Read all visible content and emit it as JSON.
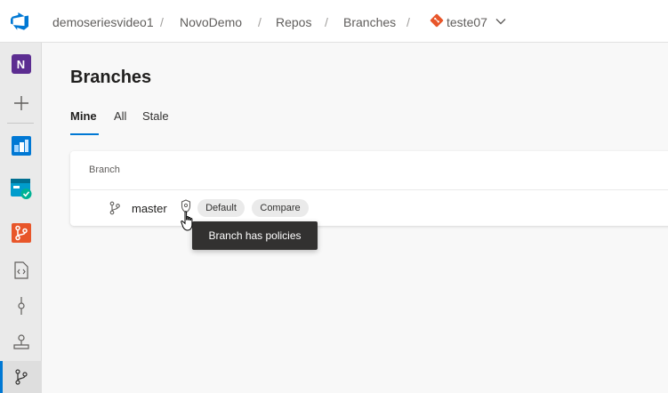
{
  "breadcrumb": {
    "organization": "demoseriesvideo1",
    "project": "NovoDemo",
    "section": "Repos",
    "page": "Branches",
    "repository": "teste07",
    "separator": "/"
  },
  "sidebar": {
    "project_initial": "N",
    "items": [
      {
        "icon": "project-badge"
      },
      {
        "icon": "plus-icon"
      },
      {
        "icon": "boards-icon"
      },
      {
        "icon": "test-plans-icon"
      },
      {
        "icon": "repos-icon"
      },
      {
        "icon": "files-icon"
      },
      {
        "icon": "commits-icon"
      },
      {
        "icon": "pushes-icon"
      },
      {
        "icon": "branches-icon",
        "active": true
      }
    ]
  },
  "main": {
    "title": "Branches",
    "tabs": [
      {
        "label": "Mine",
        "active": true
      },
      {
        "label": "All"
      },
      {
        "label": "Stale"
      }
    ],
    "table": {
      "column_header": "Branch",
      "rows": [
        {
          "name": "master",
          "badges": [
            "Default",
            "Compare"
          ]
        }
      ]
    },
    "tooltip": "Branch has policies"
  },
  "colors": {
    "accent": "#0078d4",
    "project_badge": "#5c2d91",
    "repos_orange": "#e8562a",
    "tooltip_bg": "#323130"
  }
}
